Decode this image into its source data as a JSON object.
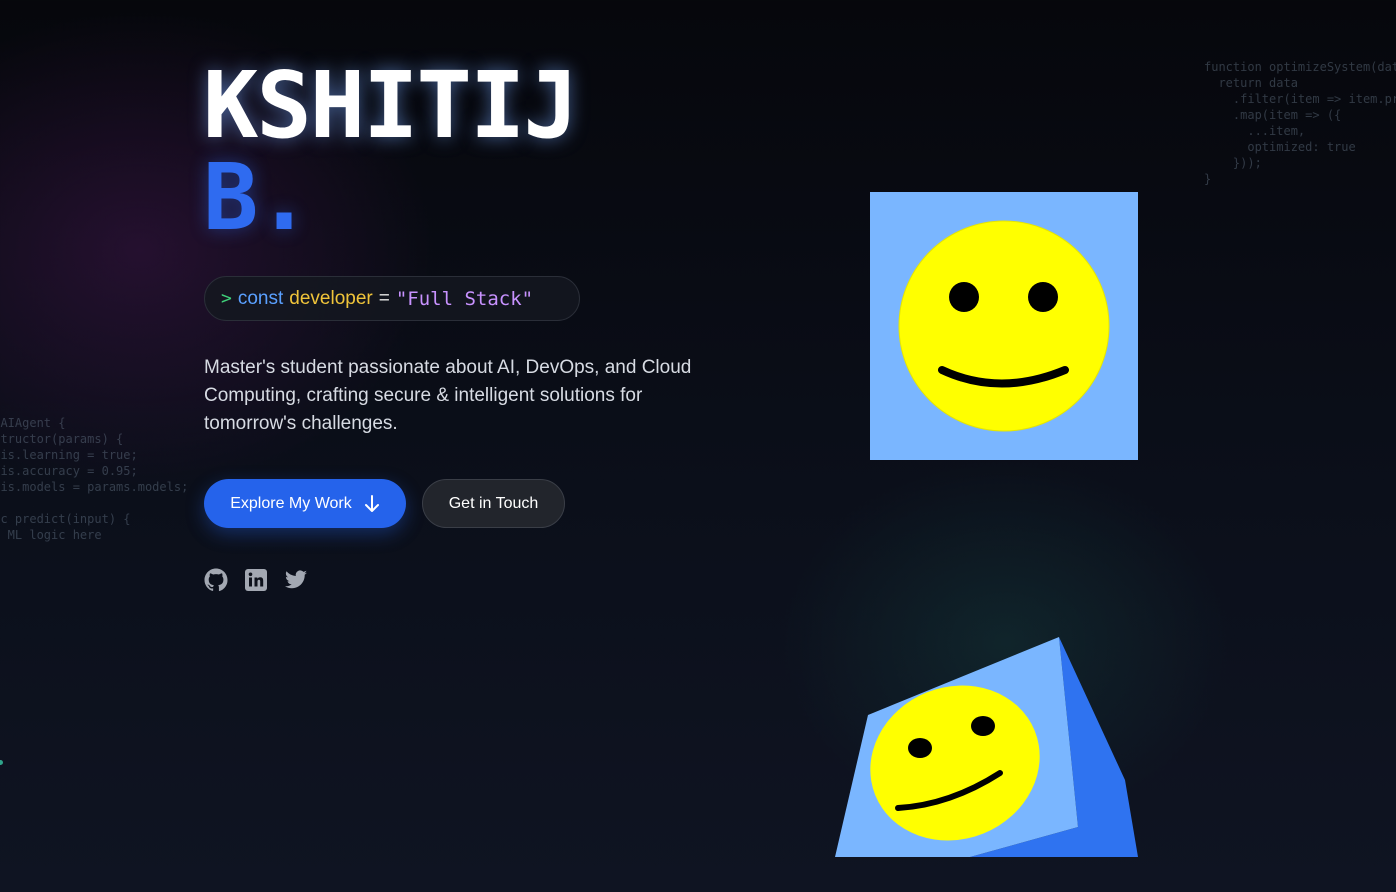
{
  "background_code": {
    "left": "s AIAgent {\nnstructor(params) {\nthis.learning = true;\nthis.accuracy = 0.95;\nthis.models = params.models;\n\nync predict(input) {\n// ML logic here",
    "right": "function optimizeSystem(data\n  return data\n    .filter(item => item.pr\n    .map(item => ({\n      ...item,\n      optimized: true\n    }));\n}"
  },
  "hero": {
    "first_name": "KSHITIJ",
    "last_name": "B.",
    "code_line": {
      "prompt": ">",
      "keyword": "const",
      "variable": "developer",
      "operator": "=",
      "value": "\"Full Stack\""
    },
    "description": "Master's student passionate about AI, DevOps, and Cloud Computing, crafting secure & intelligent solutions for tomorrow's challenges.",
    "primary_button": "Explore My Work",
    "secondary_button": "Get in Touch"
  },
  "social_icons": [
    "github-icon",
    "linkedin-icon",
    "twitter-icon"
  ],
  "colors": {
    "accent": "#2563eb",
    "smiley_bg": "#7ab6ff",
    "smiley_face": "#ffff00"
  }
}
